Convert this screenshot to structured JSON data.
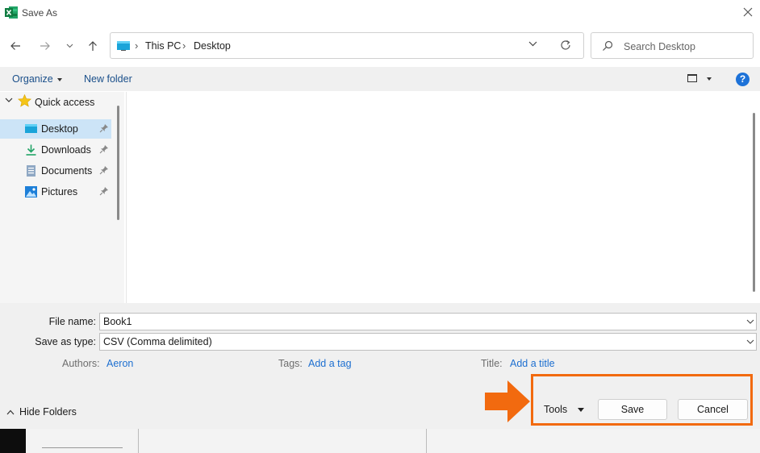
{
  "window": {
    "title": "Save As"
  },
  "nav": {
    "breadcrumb": [
      "This PC",
      "Desktop"
    ],
    "search_placeholder": "Search Desktop"
  },
  "toolbar": {
    "organize": "Organize",
    "new_folder": "New folder",
    "help": "?"
  },
  "sidebar": {
    "quick_access": "Quick access",
    "items": [
      {
        "label": "Desktop",
        "icon": "desktop-icon",
        "selected": true
      },
      {
        "label": "Downloads",
        "icon": "downloads-icon",
        "selected": false
      },
      {
        "label": "Documents",
        "icon": "documents-icon",
        "selected": false
      },
      {
        "label": "Pictures",
        "icon": "pictures-icon",
        "selected": false
      }
    ]
  },
  "form": {
    "file_name_label": "File name:",
    "file_name_value": "Book1",
    "save_type_label": "Save as type:",
    "save_type_value": "CSV (Comma delimited)",
    "authors_label": "Authors:",
    "authors_value": "Aeron",
    "tags_label": "Tags:",
    "tags_value": "Add a tag",
    "title_label": "Title:",
    "title_value": "Add a title"
  },
  "footer": {
    "hide_folders": "Hide Folders",
    "tools": "Tools",
    "save": "Save",
    "cancel": "Cancel"
  },
  "colors": {
    "accent": "#1d72d8",
    "link": "#1d6fd0",
    "highlight": "#f26a0f",
    "selection": "#cce4f7"
  }
}
